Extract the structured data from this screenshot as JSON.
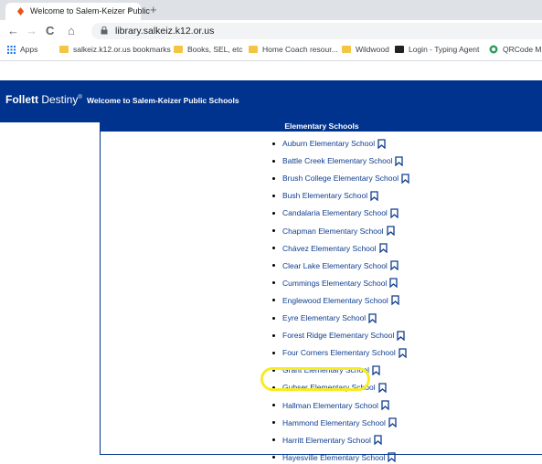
{
  "browser": {
    "tab_title": "Welcome to Salem-Keizer Public",
    "tab_close": "×",
    "new_tab": "+",
    "back": "←",
    "forward": "→",
    "reload": "C",
    "home": "⌂",
    "url": "library.salkeiz.k12.or.us"
  },
  "bookmarks": [
    {
      "label": "Apps",
      "icon": "apps-icon"
    },
    {
      "label": "salkeiz.k12.or.us bookmarks",
      "icon": "folder-icon"
    },
    {
      "label": "Books, SEL, etc",
      "icon": "folder-icon"
    },
    {
      "label": "Home Coach resour...",
      "icon": "folder-icon"
    },
    {
      "label": "Wildwood",
      "icon": "folder-icon"
    },
    {
      "label": "Login - Typing Agent",
      "icon": "typing-agent-icon"
    },
    {
      "label": "QRCode M",
      "icon": "qrcode-icon"
    }
  ],
  "header": {
    "brand_bold": "Follett",
    "brand_rest": " Destiny",
    "brand_mark": "®",
    "welcome": "Welcome to Salem-Keizer Public Schools"
  },
  "panel": {
    "title": "Elementary Schools",
    "schools": [
      "Auburn Elementary School",
      "Battle Creek Elementary School",
      "Brush College Elementary School",
      "Bush Elementary School",
      "Candalaria Elementary School",
      "Chapman Elementary School",
      "Chávez Elementary School",
      "Clear Lake Elementary School",
      "Cummings Elementary School",
      "Englewood Elementary School",
      "Eyre Elementary School",
      "Forest Ridge Elementary School",
      "Four Corners Elementary School",
      "Grant Elementary School",
      "Gubser Elementary School",
      "Hallman Elementary School",
      "Hammond Elementary School",
      "Harritt Elementary School",
      "Hayesville Elementary School"
    ]
  },
  "colors": {
    "brand_blue": "#00338d",
    "highlight": "#f7ec23"
  }
}
